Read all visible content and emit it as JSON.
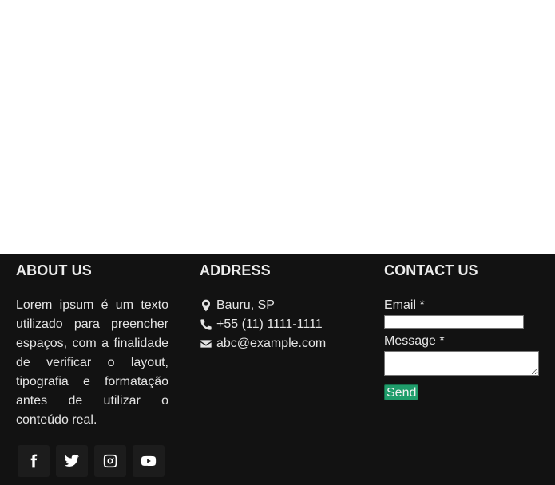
{
  "footer": {
    "about": {
      "heading": "ABOUT US",
      "text": "Lorem ipsum é um texto utilizado para preencher espaços, com a finalidade de verificar o layout, tipografia e formatação antes de utilizar o conteúdo real.",
      "social": [
        "facebook-icon",
        "twitter-icon",
        "instagram-icon",
        "youtube-icon"
      ]
    },
    "address": {
      "heading": "ADDRESS",
      "location": "Bauru, SP",
      "phone": "+55 (11) 1111-1111",
      "email": "abc@example.com"
    },
    "contact": {
      "heading": "CONTACT US",
      "email_label": "Email *",
      "email_value": "",
      "message_label": "Message *",
      "message_value": "",
      "send_label": "Send"
    }
  },
  "colors": {
    "footer_bg": "#121212",
    "send_button": "#1f9d6b",
    "text": "#e4e4e4"
  }
}
